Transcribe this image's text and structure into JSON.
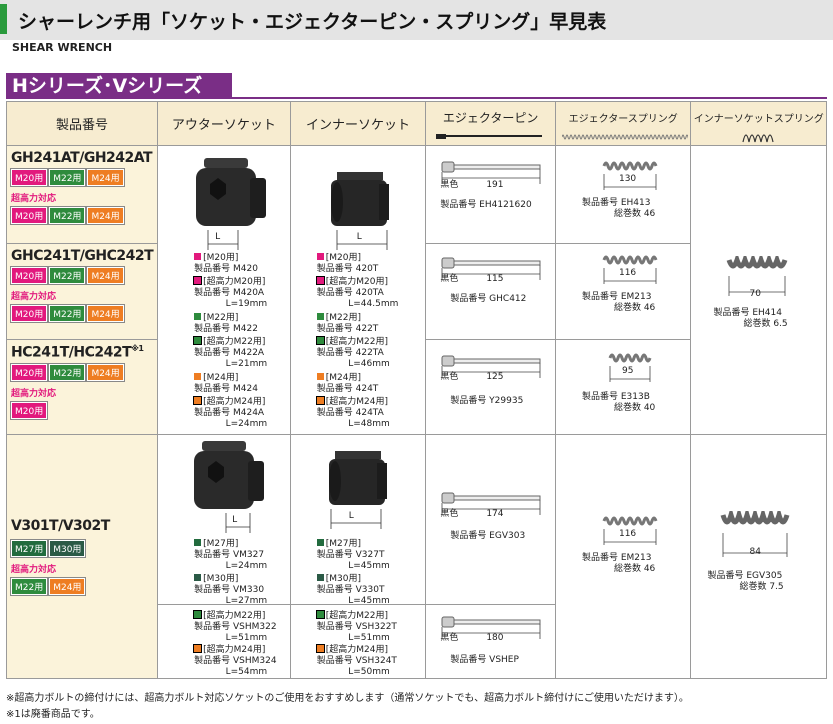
{
  "title": "シャーレンチ用「ソケット・エジェクターピン・スプリング」早見表",
  "subtitle": "SHEAR WRENCH",
  "series": "Hシリーズ･Vシリーズ",
  "headers": [
    "製品番号",
    "アウターソケット",
    "インナーソケット",
    "エジェクターピン",
    "エジェクタースプリング",
    "インナーソケットスプリング"
  ],
  "tag": {
    "m20": "M20用",
    "m22": "M22用",
    "m24": "M24用",
    "m27": "M27用",
    "m30": "M30用"
  },
  "hi_strength": "超高力対応",
  "products": [
    "GH241AT/GH242AT",
    "GHC241T/GHC242T",
    "HC241T/HC242T",
    "V301T/V302T"
  ],
  "note_mark": "※1",
  "dim_L": "L",
  "outer_h": [
    {
      "cat": "[M20用]",
      "no": "製品番号  M420"
    },
    {
      "cat": "[超高力M20用]",
      "no": "製品番号  M420A",
      "len": "L=19mm"
    },
    {
      "cat": "[M22用]",
      "no": "製品番号  M422"
    },
    {
      "cat": "[超高力M22用]",
      "no": "製品番号  M422A",
      "len": "L=21mm"
    },
    {
      "cat": "[M24用]",
      "no": "製品番号  M424"
    },
    {
      "cat": "[超高力M24用]",
      "no": "製品番号  M424A",
      "len": "L=24mm"
    }
  ],
  "inner_h": [
    {
      "cat": "[M20用]",
      "no": "製品番号  420T"
    },
    {
      "cat": "[超高力M20用]",
      "no": "製品番号  420TA",
      "len": "L=44.5mm"
    },
    {
      "cat": "[M22用]",
      "no": "製品番号  422T"
    },
    {
      "cat": "[超高力M22用]",
      "no": "製品番号  422TA",
      "len": "L=46mm"
    },
    {
      "cat": "[M24用]",
      "no": "製品番号  424T"
    },
    {
      "cat": "[超高力M24用]",
      "no": "製品番号  424TA",
      "len": "L=48mm"
    }
  ],
  "outer_v": [
    {
      "cat": "[M27用]",
      "no": "製品番号  VM327",
      "len": "L=24mm"
    },
    {
      "cat": "[M30用]",
      "no": "製品番号  VM330",
      "len": "L=27mm"
    }
  ],
  "inner_v": [
    {
      "cat": "[M27用]",
      "no": "製品番号  V327T",
      "len": "L=45mm"
    },
    {
      "cat": "[M30用]",
      "no": "製品番号  V330T",
      "len": "L=45mm"
    }
  ],
  "outer_v2": [
    {
      "cat": "[超高力M22用]",
      "no": "製品番号  VSHM322",
      "len": "L=51mm"
    },
    {
      "cat": "[超高力M24用]",
      "no": "製品番号  VSHM324",
      "len": "L=54mm"
    }
  ],
  "inner_v2": [
    {
      "cat": "[超高力M22用]",
      "no": "製品番号  VSH322T",
      "len": "L=51mm"
    },
    {
      "cat": "[超高力M24用]",
      "no": "製品番号  VSH324T",
      "len": "L=50mm"
    }
  ],
  "black": "黒色",
  "pins": [
    {
      "len": "191",
      "no": "製品番号  EH4121620"
    },
    {
      "len": "115",
      "no": "製品番号  GHC412"
    },
    {
      "len": "125",
      "no": "製品番号  Y29935"
    },
    {
      "len": "174",
      "no": "製品番号  EGV303"
    },
    {
      "len": "180",
      "no": "製品番号  VSHEP"
    }
  ],
  "springs": [
    {
      "len": "130",
      "no": "製品番号  EH413",
      "turns": "総巻数  46"
    },
    {
      "len": "116",
      "no": "製品番号  EM213",
      "turns": "総巻数  46"
    },
    {
      "len": "95",
      "no": "製品番号  E313B",
      "turns": "総巻数  40"
    },
    {
      "len": "116",
      "no": "製品番号  EM213",
      "turns": "総巻数  46"
    }
  ],
  "inner_springs": [
    {
      "len": "70",
      "no": "製品番号  EH414",
      "turns": "総巻数  6.5"
    },
    {
      "len": "84",
      "no": "製品番号  EGV305",
      "turns": "総巻数  7.5"
    }
  ],
  "footnotes": [
    "※超高力ボルトの締付けには、超高力ボルト対応ソケットのご使用をおすすめします（通常ソケットでも、超高力ボルト締付けにご使用いただけます）。",
    "※1は廃番商品です。"
  ],
  "colors": {
    "m20": "#e2197d",
    "m22": "#2e8b3d",
    "m24": "#ee7d22",
    "m27": "#226b3e",
    "m30": "#2b5a46",
    "purple": "#7a2e86",
    "green_bar": "#2a9a3c"
  }
}
